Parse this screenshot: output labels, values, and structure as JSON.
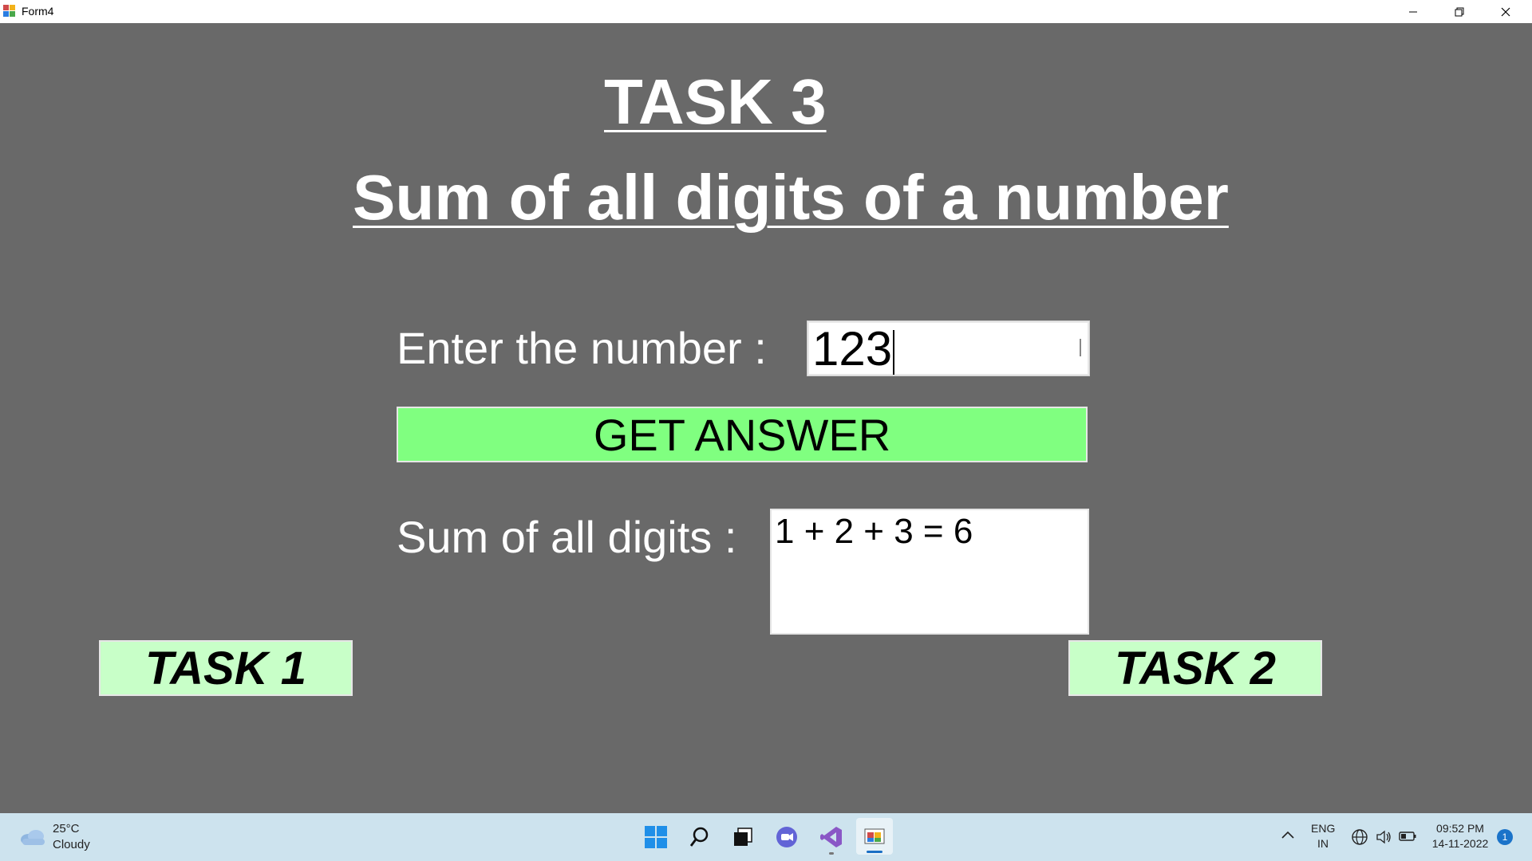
{
  "window": {
    "title": "Form4"
  },
  "form": {
    "heading": "TASK 3",
    "subheading": "Sum of all digits of a number",
    "enter_label": "Enter the number :",
    "number_value": "123",
    "get_answer_label": "GET ANSWER",
    "sum_label": "Sum of all digits :",
    "result_text": "1 + 2 + 3 = 6",
    "task1_label": "TASK 1",
    "task2_label": "TASK 2"
  },
  "colors": {
    "form_background": "#696969",
    "get_answer_button": "#80ff80",
    "task_buttons": "#c8ffc8",
    "taskbar": "#cde3ee"
  },
  "taskbar": {
    "weather": {
      "temperature": "25°C",
      "condition": "Cloudy",
      "icon": "cloud-icon"
    },
    "apps": [
      "windows-start-icon",
      "search-icon",
      "task-view-icon",
      "chat-icon",
      "visual-studio-icon",
      "form-app-icon"
    ],
    "language": {
      "line1": "ENG",
      "line2": "IN"
    },
    "time": "09:52 PM",
    "date": "14-11-2022",
    "notification_count": "1"
  }
}
